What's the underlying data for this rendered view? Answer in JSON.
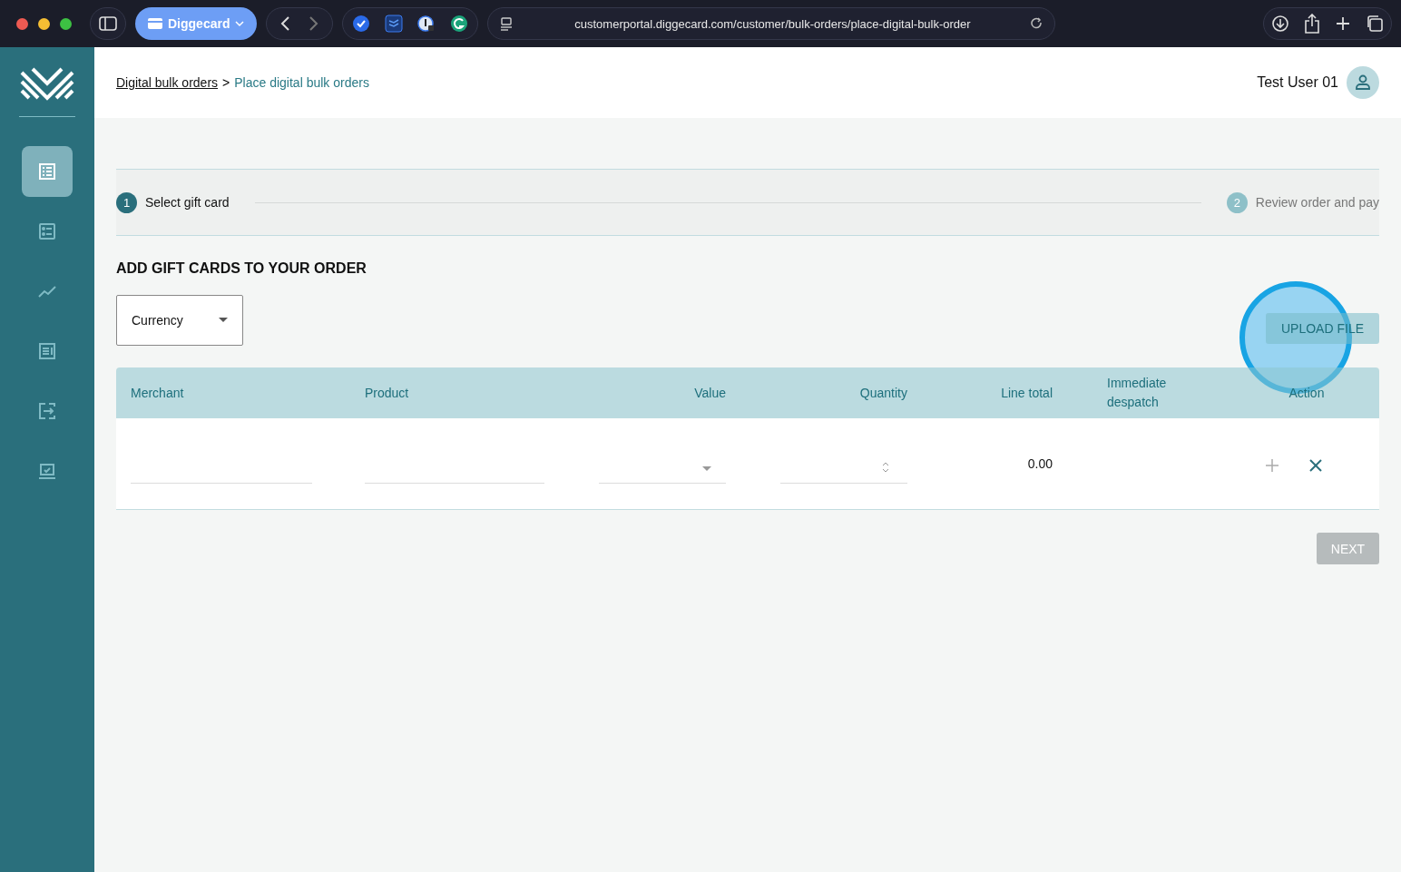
{
  "browser": {
    "tab_group": "Diggecard",
    "url": "customerportal.diggecard.com/customer/bulk-orders/place-digital-bulk-order"
  },
  "sidebar": {
    "items": [
      {
        "kind": "list",
        "selected": true
      },
      {
        "kind": "checklist",
        "selected": false
      },
      {
        "kind": "chart",
        "selected": false
      },
      {
        "kind": "document",
        "selected": false
      },
      {
        "kind": "transfer",
        "selected": false
      },
      {
        "kind": "laptop",
        "selected": false
      }
    ]
  },
  "breadcrumb": {
    "parent": "Digital bulk orders",
    "separator": ">",
    "current": "Place digital bulk orders"
  },
  "user": {
    "name": "Test User 01"
  },
  "steps": [
    {
      "number": "1",
      "label": "Select gift card",
      "selected": true
    },
    {
      "number": "2",
      "label": "Review order and pay",
      "selected": false
    }
  ],
  "section_title": "ADD GIFT CARDS TO YOUR ORDER",
  "currency_select": {
    "placeholder": "Currency"
  },
  "upload_button": {
    "label": "UPLOAD FILE"
  },
  "table": {
    "columns": [
      "Merchant",
      "Product",
      "Value",
      "Quantity",
      "Line total",
      "Immediate despatch",
      "Action"
    ],
    "rows": [
      {
        "line_total": "0.00"
      }
    ]
  },
  "next_button": {
    "label": "NEXT",
    "disabled": true
  }
}
